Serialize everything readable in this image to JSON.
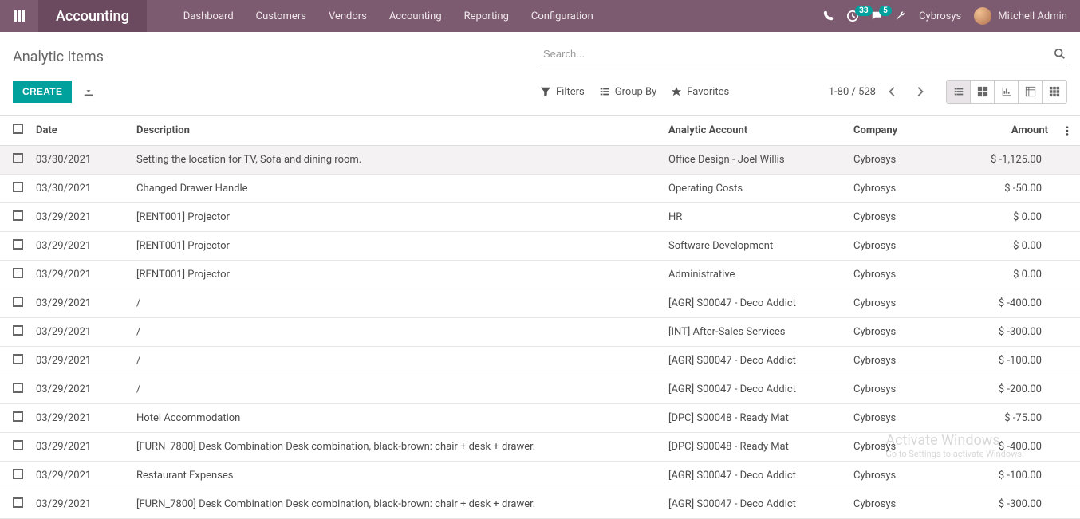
{
  "topnav": {
    "app_title": "Accounting",
    "menu": [
      "Dashboard",
      "Customers",
      "Vendors",
      "Accounting",
      "Reporting",
      "Configuration"
    ],
    "badges": {
      "activities": "33",
      "messages": "5"
    },
    "company": "Cybrosys",
    "user": "Mitchell Admin"
  },
  "cp": {
    "title": "Analytic Items",
    "search_placeholder": "Search...",
    "create_label": "CREATE",
    "filters_label": "Filters",
    "groupby_label": "Group By",
    "favorites_label": "Favorites",
    "paging": "1-80 / 528"
  },
  "table": {
    "headers": {
      "date": "Date",
      "description": "Description",
      "analytic_account": "Analytic Account",
      "company": "Company",
      "amount": "Amount"
    },
    "rows": [
      {
        "date": "03/30/2021",
        "description": "Setting the location for TV, Sofa and dining room.",
        "account": "Office Design - Joel Willis",
        "company": "Cybrosys",
        "amount": "$ -1,125.00"
      },
      {
        "date": "03/30/2021",
        "description": "Changed Drawer Handle",
        "account": "Operating Costs",
        "company": "Cybrosys",
        "amount": "$ -50.00"
      },
      {
        "date": "03/29/2021",
        "description": "[RENT001] Projector",
        "account": "HR",
        "company": "Cybrosys",
        "amount": "$ 0.00"
      },
      {
        "date": "03/29/2021",
        "description": "[RENT001] Projector",
        "account": "Software Development",
        "company": "Cybrosys",
        "amount": "$ 0.00"
      },
      {
        "date": "03/29/2021",
        "description": "[RENT001] Projector",
        "account": "Administrative",
        "company": "Cybrosys",
        "amount": "$ 0.00"
      },
      {
        "date": "03/29/2021",
        "description": "/",
        "account": "[AGR] S00047 - Deco Addict",
        "company": "Cybrosys",
        "amount": "$ -400.00"
      },
      {
        "date": "03/29/2021",
        "description": "/",
        "account": "[INT] After-Sales Services",
        "company": "Cybrosys",
        "amount": "$ -300.00"
      },
      {
        "date": "03/29/2021",
        "description": "/",
        "account": "[AGR] S00047 - Deco Addict",
        "company": "Cybrosys",
        "amount": "$ -100.00"
      },
      {
        "date": "03/29/2021",
        "description": "/",
        "account": "[AGR] S00047 - Deco Addict",
        "company": "Cybrosys",
        "amount": "$ -200.00"
      },
      {
        "date": "03/29/2021",
        "description": "Hotel Accommodation",
        "account": "[DPC] S00048 - Ready Mat",
        "company": "Cybrosys",
        "amount": "$ -75.00"
      },
      {
        "date": "03/29/2021",
        "description": "[FURN_7800] Desk Combination Desk combination, black-brown: chair + desk + drawer.",
        "account": "[DPC] S00048 - Ready Mat",
        "company": "Cybrosys",
        "amount": "$ -400.00"
      },
      {
        "date": "03/29/2021",
        "description": "Restaurant Expenses",
        "account": "[AGR] S00047 - Deco Addict",
        "company": "Cybrosys",
        "amount": "$ -100.00"
      },
      {
        "date": "03/29/2021",
        "description": "[FURN_7800] Desk Combination Desk combination, black-brown: chair + desk + drawer.",
        "account": "[AGR] S00047 - Deco Addict",
        "company": "Cybrosys",
        "amount": "$ -300.00"
      }
    ]
  },
  "watermark": {
    "line1": "Activate Windows",
    "line2": "Go to Settings to activate Windows."
  }
}
